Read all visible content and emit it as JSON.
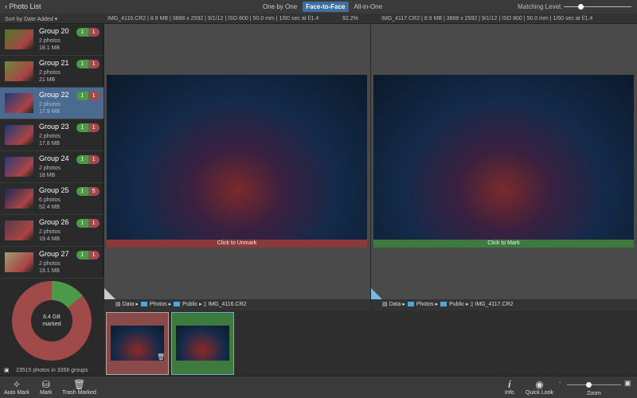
{
  "header": {
    "back_label": "Photo List",
    "modes": [
      "One by One",
      "Face-to-Face",
      "All-in-One"
    ],
    "active_mode": 1,
    "matching_label": "Matching Level:",
    "matching_level": 0.25
  },
  "info": {
    "sort_label": "Sort by Date Added",
    "left": "IMG_4116.CR2 | 8.9 MB | 3888 x 2592 | 9/1/12 | ISO 800 | 50.0 mm | 1/60 sec at f/1.4",
    "similarity": "92.2%",
    "right": "IMG_4117.CR2 | 8.9 MB | 3888 x 2592 | 9/1/12 | ISO 800 | 50.0 mm | 1/60 sec at f/1.4"
  },
  "groups": [
    {
      "name": "Group 20",
      "photos": "2 photos",
      "size": "18.1 MB",
      "keep": "1",
      "trash": "1"
    },
    {
      "name": "Group 21",
      "photos": "2 photos",
      "size": "21 MB",
      "keep": "1",
      "trash": "1"
    },
    {
      "name": "Group 22",
      "photos": "2 photos",
      "size": "17.9 MB",
      "keep": "1",
      "trash": "1"
    },
    {
      "name": "Group 23",
      "photos": "2 photos",
      "size": "17.8 MB",
      "keep": "1",
      "trash": "1"
    },
    {
      "name": "Group 24",
      "photos": "2 photos",
      "size": "18 MB",
      "keep": "1",
      "trash": "1"
    },
    {
      "name": "Group 25",
      "photos": "6 photos",
      "size": "52.4 MB",
      "keep": "1",
      "trash": "5"
    },
    {
      "name": "Group 26",
      "photos": "2 photos",
      "size": "19.4 MB",
      "keep": "1",
      "trash": "1"
    },
    {
      "name": "Group 27",
      "photos": "2 photos",
      "size": "19.1 MB",
      "keep": "1",
      "trash": "1"
    }
  ],
  "summary": {
    "donut_center": "6.4 GB",
    "donut_sub": "marked",
    "marked_fraction": 0.86,
    "stats": "23515 photos in 3356 groups"
  },
  "panes": [
    {
      "mark_label": "Click to Unmark",
      "path": [
        "Data",
        "Photos",
        "Public",
        "IMG_4116.CR2"
      ],
      "color": "#8a3a3a"
    },
    {
      "mark_label": "Click to Mark",
      "path": [
        "Data",
        "Photos",
        "Public",
        "IMG_4117.CR2"
      ],
      "color": "#3d7a3d"
    }
  ],
  "toolbar": {
    "auto_mark": "Auto Mark",
    "mark": "Mark",
    "trash_marked": "Trash Marked",
    "info": "Info",
    "quick_look": "Quick Look",
    "zoom": "Zoom"
  },
  "colors": {
    "keep": "#4a9a4a",
    "trash": "#a04a4a",
    "selected": "#4a6a8f",
    "accent": "#3d6fa3"
  }
}
